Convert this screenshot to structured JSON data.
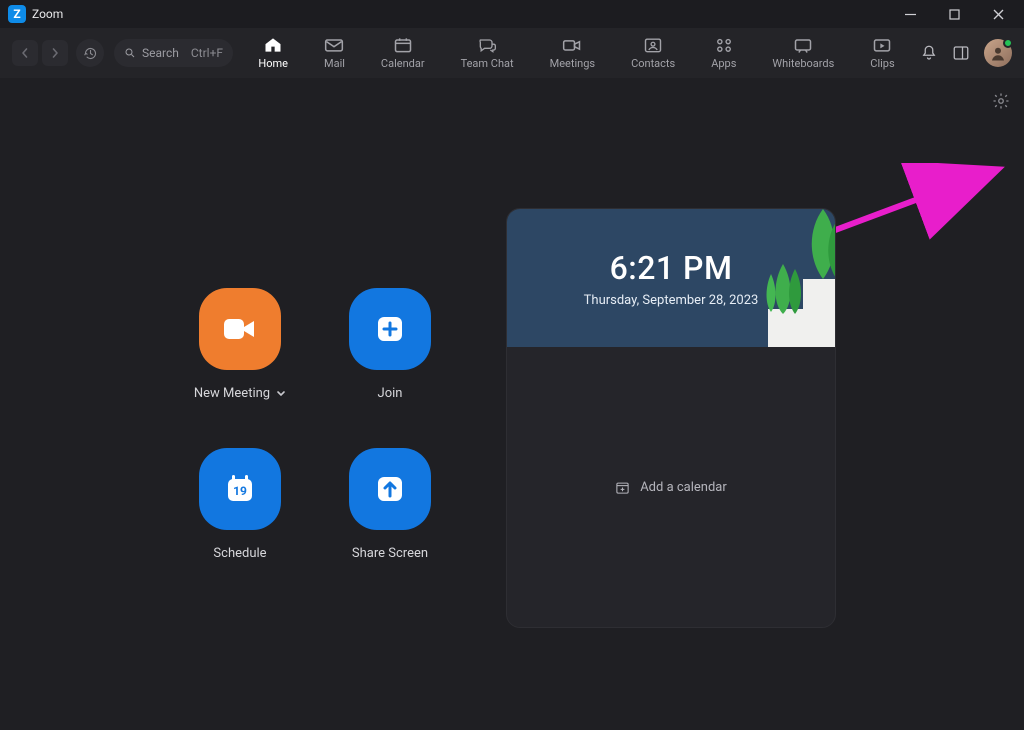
{
  "window": {
    "title": "Zoom"
  },
  "toolbar": {
    "search_label": "Search",
    "search_shortcut": "Ctrl+F",
    "tabs": [
      {
        "label": "Home",
        "icon": "home-icon",
        "active": true
      },
      {
        "label": "Mail",
        "icon": "mail-icon",
        "active": false
      },
      {
        "label": "Calendar",
        "icon": "calendar-icon",
        "active": false
      },
      {
        "label": "Team Chat",
        "icon": "chat-icon",
        "active": false
      },
      {
        "label": "Meetings",
        "icon": "video-icon",
        "active": false
      },
      {
        "label": "Contacts",
        "icon": "contacts-icon",
        "active": false
      },
      {
        "label": "Apps",
        "icon": "apps-icon",
        "active": false
      },
      {
        "label": "Whiteboards",
        "icon": "whiteboard-icon",
        "active": false
      },
      {
        "label": "Clips",
        "icon": "clips-icon",
        "active": false
      }
    ]
  },
  "actions": {
    "new_meeting": "New Meeting",
    "join": "Join",
    "schedule": "Schedule",
    "schedule_day": "19",
    "share_screen": "Share Screen"
  },
  "calendar": {
    "time": "6:21 PM",
    "date": "Thursday, September 28, 2023",
    "add_label": "Add a calendar"
  },
  "colors": {
    "orange": "#ef7d2e",
    "blue": "#1277e0",
    "annotation": "#e81ecb"
  }
}
